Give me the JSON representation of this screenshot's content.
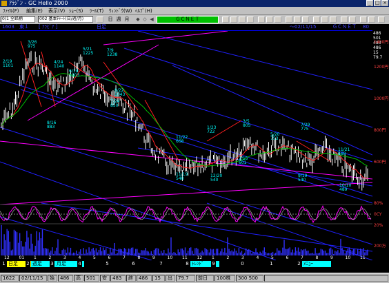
{
  "window": {
    "title": "ｱﾗｼﾞﾝ - GC Hello 2000",
    "min": "_",
    "max": "□",
    "close": "×"
  },
  "menu": [
    "ﾌｧｲﾙ(F)",
    "編集(E)",
    "表示(V)",
    "ｼｮｰ(S)",
    "ﾂｰﾙ(T)",
    "ｳｨﾝﾄﾞｳ(W)",
    "ﾍﾙﾌﾟ(H)"
  ],
  "toolbar": {
    "combo_market": "0)1 全銘柄",
    "combo_chart": "002 基本ﾁｬｰﾄ(日/週/月)",
    "btn_day": "日",
    "btn_week": "週",
    "btn_month": "月",
    "green_label": "ＧＣＮＥＴ",
    "arrows": [
      "◆",
      "◇",
      "◀",
      "▶",
      "▲",
      "▼"
    ]
  },
  "chart_header": {
    "code": "1603",
    "name": "東１",
    "company": "[ ｱﾗﾋﾞｱ ]",
    "kind": "日足",
    "date": "～02/11/15",
    "net": "ＧＣＮＥＴ",
    "suffix": "80"
  },
  "right_values": [
    "486",
    "501",
    "483",
    "486",
    "15",
    "79.7"
  ],
  "right_labels": [
    "N",
    "O",
    "H",
    "L",
    "C",
    "V",
    "%"
  ],
  "y_labels": [
    "1400円",
    "1200円",
    "1000円",
    "800円",
    "600円",
    "80%",
    "0CY",
    "20%",
    "200万"
  ],
  "price_annotations": [
    {
      "t": "2/19",
      "t2": "1101"
    },
    {
      "t": "3/26",
      "t2": "975"
    },
    {
      "t": "4/24",
      "t2": "1140"
    },
    {
      "t": "5/21",
      "t2": "1225"
    },
    {
      "t": "7/9",
      "t2": "1238"
    },
    {
      "t": "6/18",
      "t2": "1003"
    },
    {
      "t": "8/16",
      "t2": "883"
    },
    {
      "t": "7/24",
      "t2": "850"
    },
    {
      "t": "8/22",
      "t2": "1043"
    },
    {
      "t": "11/22",
      "t2": "668"
    },
    {
      "t": "1/23",
      "t2": "722"
    },
    {
      "t": "3/5",
      "t2": "805"
    },
    {
      "t": "5/20",
      "t2": "753"
    },
    {
      "t": "7/29",
      "t2": "775"
    },
    {
      "t": "11/21",
      "t2": "668"
    },
    {
      "t": "9/19",
      "t2": "540"
    },
    {
      "t": "11/19",
      "t2": "548"
    },
    {
      "t": "10/10",
      "t2": "489"
    },
    {
      "t": "12/20",
      "t2": "540"
    },
    {
      "t": "2/15",
      "t2": "601"
    }
  ],
  "x_labels": [
    "12",
    "01",
    "1",
    "2",
    "3",
    "4",
    "5",
    "6",
    "7",
    "8",
    "9",
    "10",
    "11",
    "12",
    "1",
    "2",
    "3",
    "4",
    "5",
    "6",
    "7",
    "8",
    "9",
    "10",
    "11"
  ],
  "function_keys": [
    {
      "n": "1",
      "label": "日足",
      "active": true
    },
    {
      "n": "2",
      "label": "週足",
      "active": false
    },
    {
      "n": "3",
      "label": "月足",
      "active": false
    },
    {
      "n": "4",
      "label": "",
      "active": false
    },
    {
      "n": "5",
      "label": "",
      "active": false
    },
    {
      "n": "6",
      "label": "",
      "active": false
    },
    {
      "n": "7",
      "label": "",
      "active": false
    },
    {
      "n": "8",
      "label": "ﾄﾚﾝﾄﾞ",
      "active": false
    },
    {
      "n": "9",
      "label": "",
      "active": false
    },
    {
      "n": "0",
      "label": "",
      "active": false
    },
    {
      "n": "1",
      "label": "",
      "active": false
    },
    {
      "n": "2",
      "label": "ﾒﾆｭｰ",
      "active": false
    }
  ],
  "status": {
    "code": "1622",
    "date": "02/11/15",
    "s1_label": "始",
    "s1": "486",
    "s2_label": "高",
    "s2": "501",
    "s3_label": "安",
    "s3": "483",
    "s4_label": "終",
    "s4": "486",
    "s5_label": "15",
    "s5": "出",
    "s6": "79.7",
    "s7": "前日",
    "s8": "100株",
    "s9": "300 500"
  },
  "colors": {
    "bg": "#000000",
    "price": "#ffffff",
    "trend_blue": "#2020ff",
    "trend_magenta": "#ff00ff",
    "ma_red": "#ff2020",
    "ma_green": "#00c000",
    "volume": "#3030ff"
  }
}
